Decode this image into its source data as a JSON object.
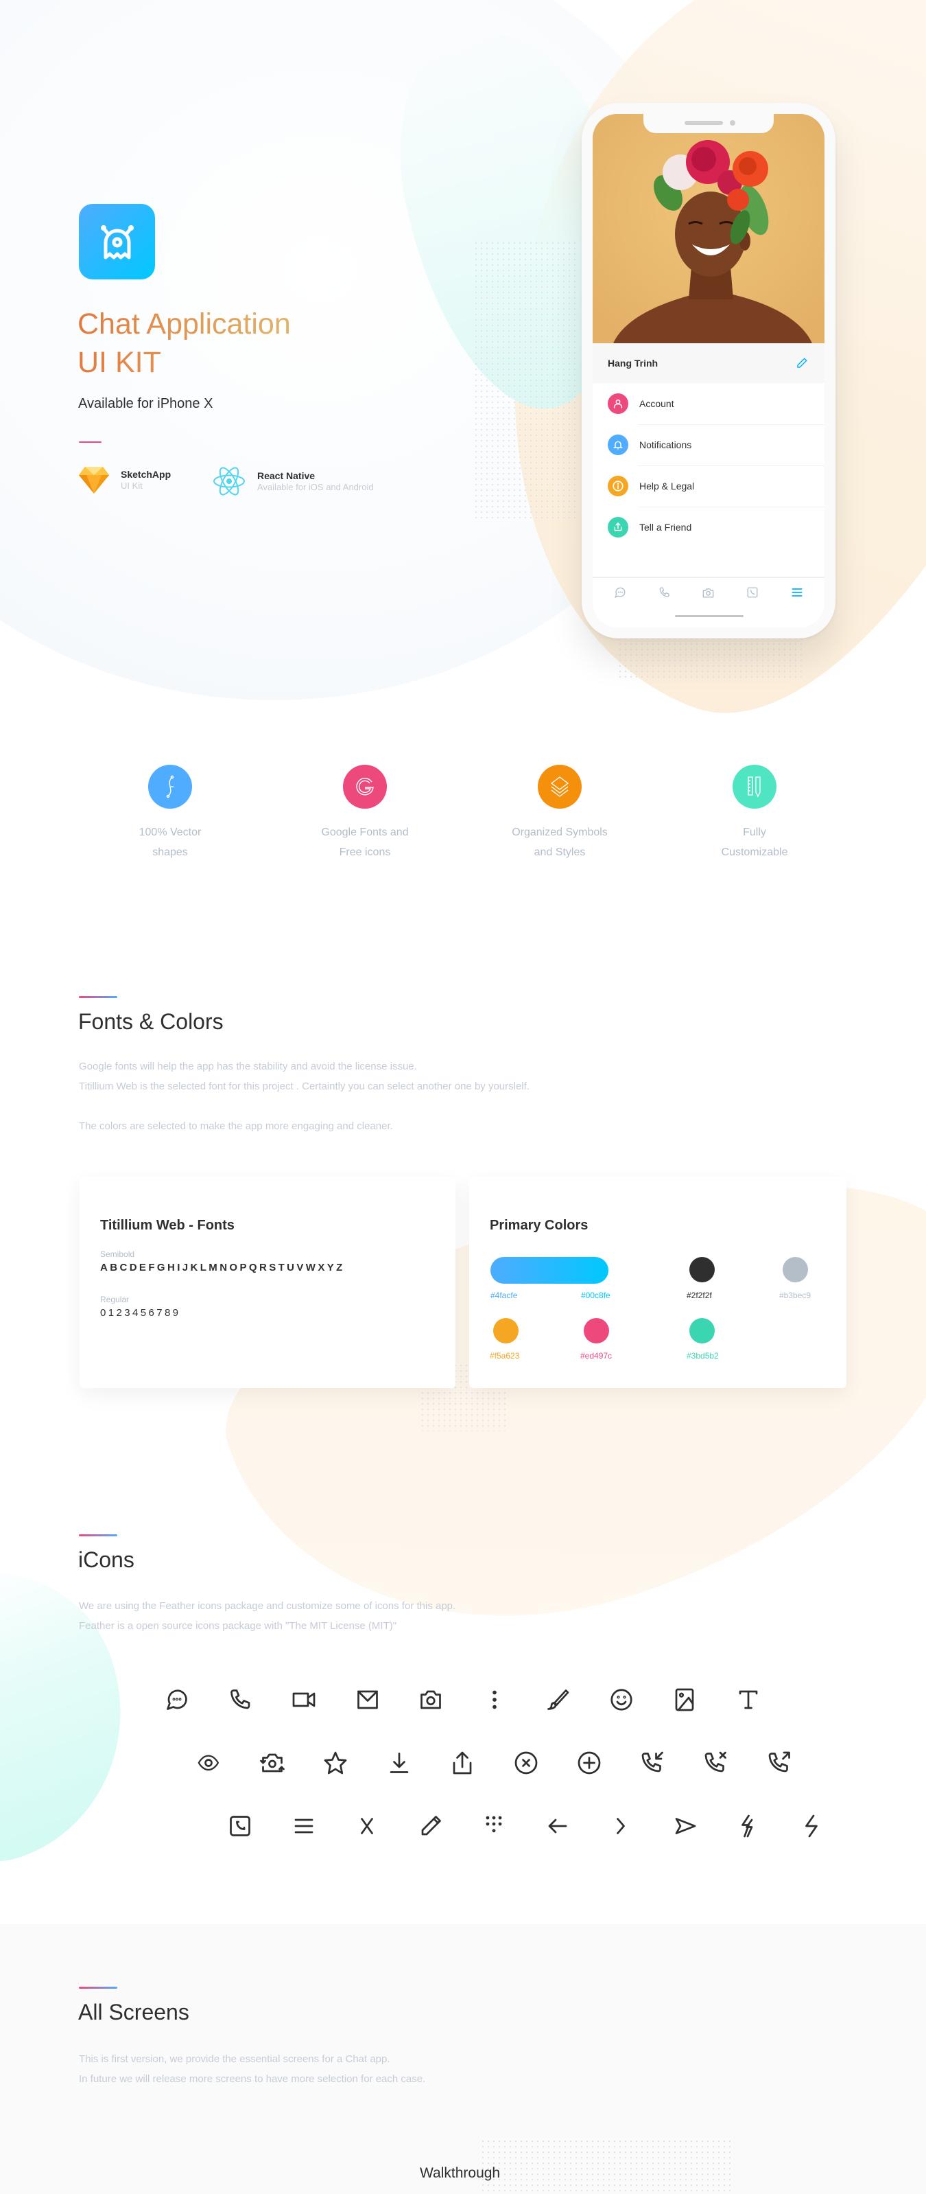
{
  "hero": {
    "app_icon": "ghost-monster-icon",
    "title_line1": "Chat Application",
    "title_line2": "UI KIT",
    "subtitle": "Available for iPhone X",
    "platforms": [
      {
        "icon": "sketch-diamond-icon",
        "name": "SketchApp",
        "desc": "UI Kit"
      },
      {
        "icon": "react-atom-icon",
        "name": "React Native",
        "desc": "Available for iOS and Android"
      }
    ]
  },
  "phone": {
    "profile_name": "Hang Trinh",
    "edit_icon": "pencil-icon",
    "menu": [
      {
        "label": "Account",
        "icon": "user-icon",
        "color": "#ed497c"
      },
      {
        "label": "Notifications",
        "icon": "bell-icon",
        "color": "#4facfe"
      },
      {
        "label": "Help & Legal",
        "icon": "info-icon",
        "color": "#f5a623"
      },
      {
        "label": "Tell a Friend",
        "icon": "share-icon",
        "color": "#3bd5b2"
      }
    ],
    "tabs": [
      {
        "icon": "chat-icon",
        "active": false
      },
      {
        "icon": "phone-icon",
        "active": false
      },
      {
        "icon": "camera-icon",
        "active": false
      },
      {
        "icon": "phone-square-icon",
        "active": false
      },
      {
        "icon": "menu-icon",
        "active": true
      }
    ],
    "accent": "#00c8fe"
  },
  "features": [
    {
      "label": "100% Vector\nshapes",
      "icon": "vector-path-icon",
      "color": "#4facfe"
    },
    {
      "label": "Google Fonts and\nFree icons",
      "icon": "google-g-icon",
      "color": "#ed497c"
    },
    {
      "label": "Organized Symbols\nand Styles",
      "icon": "layers-icon",
      "color": "#f5a623"
    },
    {
      "label": "Fully\nCustomizable",
      "icon": "ruler-pencil-icon",
      "color": "#3bd5b2"
    }
  ],
  "fonts_colors": {
    "title": "Fonts & Colors",
    "desc_line1": "Google fonts will help the app has the  stability and avoid the license issue.",
    "desc_line2": "Titillium Web is the selected font for this project . Certaintly you can select another one by yourslelf.",
    "desc_line3": "The colors are selected to make the app more engaging and cleaner.",
    "font_card": {
      "title": "Titillium Web -  Fonts",
      "semibold_label": "Semibold",
      "semibold_sample": "ABCDEFGHIJKLMNOPQRSTUVWXYZ",
      "regular_label": "Regular",
      "regular_sample": "0123456789"
    },
    "color_card": {
      "title": "Primary Colors",
      "gradient": {
        "from": "#4facfe",
        "to": "#00c8fe"
      },
      "swatches": [
        "#2f2f2f",
        "#b3bec9",
        "#f5a623",
        "#ed497c",
        "#3bd5b2"
      ]
    }
  },
  "icons_section": {
    "title": "iCons",
    "desc_line1": "We are using the Feather icons package and customize some of icons for this app.",
    "desc_line2": "Feather is a open source icons package with \"The MIT License (MIT)\"",
    "rows": [
      [
        "message-circle-icon",
        "phone-icon",
        "video-icon",
        "mail-icon",
        "camera-icon",
        "more-vertical-icon",
        "brush-icon",
        "smile-icon",
        "image-icon",
        "type-icon"
      ],
      [
        "eye-icon",
        "camera-flip-icon",
        "star-icon",
        "download-icon",
        "share-upload-icon",
        "x-circle-icon",
        "plus-circle-icon",
        "phone-incoming-icon",
        "phone-missed-icon",
        "phone-outgoing-icon"
      ],
      [
        "phone-square-icon",
        "menu-icon",
        "x-icon",
        "pencil-icon",
        "dialpad-icon",
        "arrow-left-icon",
        "chevron-right-icon",
        "send-icon",
        "flash-off-icon",
        "flash-icon"
      ]
    ]
  },
  "all_screens": {
    "title": "All Screens",
    "desc_line1": "This is first version, we provide the essential screens for a Chat app.",
    "desc_line2": "In future we will release more screens to have more selection for each case.",
    "first_group": "Walkthrough"
  }
}
